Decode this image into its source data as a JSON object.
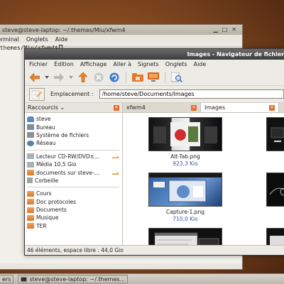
{
  "terminal": {
    "title": "steve@steve-laptop: ~/.themes/Miu/xfwm4",
    "menus": [
      "Terminal",
      "Onglets",
      "Aide"
    ],
    "prompt": ".themes/Miu/xfwm4$"
  },
  "filemanager": {
    "title": "Images - Navigateur de fichiers",
    "menus": [
      "Fichier",
      "Édition",
      "Affichage",
      "Aller à",
      "Signets",
      "Onglets",
      "Aide"
    ],
    "location_label": "Emplacement :",
    "location_value": "/home/steve/Documents/Images",
    "sidebar_title": "Raccourcis",
    "places": [
      {
        "label": "steve",
        "icon": "user-home-icon"
      },
      {
        "label": "Bureau",
        "icon": "desktop-icon"
      },
      {
        "label": "Système de fichiers",
        "icon": "filesystem-icon"
      },
      {
        "label": "Réseau",
        "icon": "network-icon"
      },
      {
        "label": "Lecteur CD-RW/DVD±...",
        "icon": "optical-drive-icon",
        "eject": true
      },
      {
        "label": "Média 10,5 Gio",
        "icon": "drive-icon"
      },
      {
        "label": "documents sur steve-...",
        "icon": "network-folder-icon",
        "eject": true
      },
      {
        "label": "Corbeille",
        "icon": "trash-icon"
      }
    ],
    "bookmarks": [
      "Cours",
      "Doc protocoles",
      "Documents",
      "Musique",
      "TER"
    ],
    "tabs": [
      {
        "label": "xfwm4"
      },
      {
        "label": "Images"
      }
    ],
    "files": [
      {
        "name": "Alt-Tab.png",
        "size": "923,3 Kio"
      },
      {
        "name": "Capture-1.png",
        "size": "710,0 Kio"
      }
    ],
    "status": "46 éléments, espace libre : 44,0 Gio"
  },
  "taskbar": {
    "items": [
      {
        "label": "ers"
      },
      {
        "label": "steve@steve-laptop: ~/.themes..."
      }
    ]
  },
  "colors": {
    "accent_orange": "#e46b2c",
    "size_text": "#3b57a8",
    "titlebar_dark": "#3c3c3c"
  }
}
